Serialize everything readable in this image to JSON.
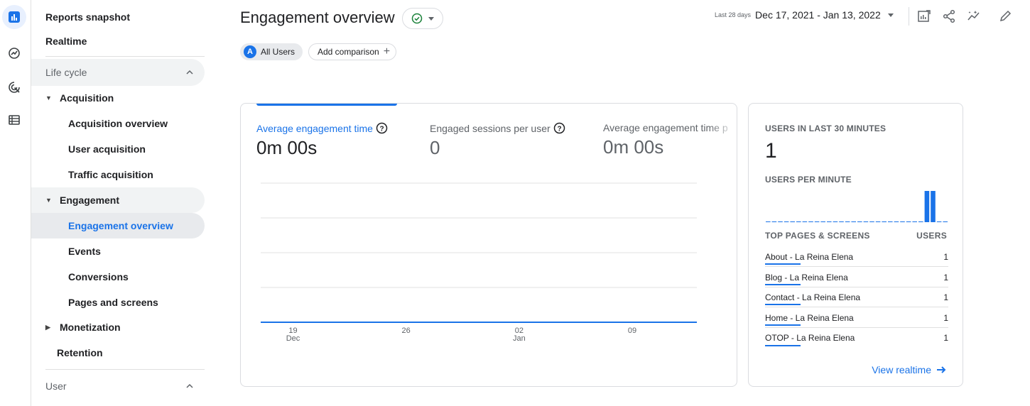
{
  "rail": {
    "items": [
      {
        "icon": "bar-chart-icon",
        "active": true
      },
      {
        "icon": "trending-icon",
        "active": false
      },
      {
        "icon": "target-click-icon",
        "active": false
      },
      {
        "icon": "list-icon",
        "active": false
      }
    ]
  },
  "nav": {
    "reports_snapshot": "Reports snapshot",
    "realtime": "Realtime",
    "lifecycle_label": "Life cycle",
    "acquisition": "Acquisition",
    "acquisition_overview": "Acquisition overview",
    "user_acquisition": "User acquisition",
    "traffic_acquisition": "Traffic acquisition",
    "engagement": "Engagement",
    "engagement_overview": "Engagement overview",
    "events": "Events",
    "conversions": "Conversions",
    "pages_and_screens": "Pages and screens",
    "monetization": "Monetization",
    "retention": "Retention",
    "user_label": "User"
  },
  "header": {
    "title": "Engagement overview",
    "all_users": "All Users",
    "avatar_letter": "A",
    "add_comparison": "Add comparison",
    "date_hint": "Last 28 days",
    "date_range": "Dec 17, 2021 - Jan 13, 2022"
  },
  "metrics": [
    {
      "label": "Average engagement time",
      "value": "0m 00s",
      "active": true
    },
    {
      "label": "Engaged sessions per user",
      "value": "0",
      "active": false
    },
    {
      "label": "Average engagement time p",
      "value": "0m 00s",
      "active": false
    }
  ],
  "chart_data": {
    "type": "line",
    "x_ticks": [
      {
        "day": "19",
        "month": "Dec"
      },
      {
        "day": "26",
        "month": ""
      },
      {
        "day": "02",
        "month": "Jan"
      },
      {
        "day": "09",
        "month": ""
      }
    ],
    "series": [
      {
        "values": [
          0,
          0,
          0,
          0,
          0,
          0,
          0,
          0,
          0,
          0,
          0,
          0,
          0,
          0,
          0,
          0,
          0,
          0,
          0,
          0,
          0,
          0,
          0,
          0,
          0,
          0,
          0,
          0
        ]
      }
    ],
    "grid": true,
    "color": "#1a73e8"
  },
  "realtime": {
    "title": "USERS IN LAST 30 MINUTES",
    "count": "1",
    "per_minute_label": "USERS PER MINUTE",
    "per_minute_values": [
      0,
      0,
      0,
      0,
      0,
      0,
      0,
      0,
      0,
      0,
      0,
      0,
      0,
      0,
      0,
      0,
      0,
      0,
      0,
      0,
      0,
      0,
      0,
      0,
      0,
      0,
      1,
      1,
      0,
      0
    ],
    "table_header_pages": "TOP PAGES & SCREENS",
    "table_header_users": "USERS",
    "rows": [
      {
        "page": "About - La Reina Elena",
        "users": "1"
      },
      {
        "page": "Blog - La Reina Elena",
        "users": "1"
      },
      {
        "page": "Contact - La Reina Elena",
        "users": "1"
      },
      {
        "page": "Home - La Reina Elena",
        "users": "1"
      },
      {
        "page": "OTOP - La Reina Elena",
        "users": "1"
      }
    ],
    "view_link": "View realtime"
  },
  "colors": {
    "accent": "#1a73e8",
    "success": "#188038"
  }
}
